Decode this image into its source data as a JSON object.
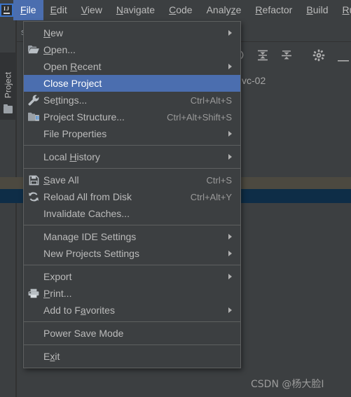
{
  "app": {
    "logo_text": "IJ",
    "logo_name": "intellij-idea-logo"
  },
  "menubar": {
    "items": [
      {
        "label": "File",
        "mnemonic": "F",
        "selected": true
      },
      {
        "label": "Edit",
        "mnemonic": "E",
        "selected": false
      },
      {
        "label": "View",
        "mnemonic": "V",
        "selected": false
      },
      {
        "label": "Navigate",
        "mnemonic": "N",
        "selected": false
      },
      {
        "label": "Code",
        "mnemonic": "C",
        "selected": false
      },
      {
        "label": "Analyze",
        "mnemonic": "z",
        "selected": false
      },
      {
        "label": "Refactor",
        "mnemonic": "R",
        "selected": false
      },
      {
        "label": "Build",
        "mnemonic": "B",
        "selected": false
      },
      {
        "label": "Run",
        "mnemonic": "R",
        "selected": false
      }
    ]
  },
  "tool_window": {
    "project_tab_label": "Project",
    "project_tab_icon": "folder-icon",
    "partial_label": "sp",
    "toolbar_icons": [
      {
        "name": "locate-icon"
      },
      {
        "name": "collapse-all-icon"
      },
      {
        "name": "expand-all-icon"
      },
      {
        "name": "gear-icon"
      },
      {
        "name": "minimize-icon"
      }
    ],
    "selected_node_text": "vc-02",
    "partial_node_text": "s"
  },
  "watermark": {
    "text": "CSDN @杨大脸I"
  },
  "file_menu": {
    "groups": [
      {
        "items": [
          {
            "label": "New",
            "mnemonic": "N",
            "icon": null,
            "shortcut": null,
            "submenu": true,
            "highlighted": false
          },
          {
            "label": "Open...",
            "mnemonic": "O",
            "icon": "open-folder-icon",
            "shortcut": null,
            "submenu": false,
            "highlighted": false
          },
          {
            "label": "Open Recent",
            "mnemonic": "R",
            "icon": null,
            "shortcut": null,
            "submenu": true,
            "highlighted": false
          },
          {
            "label": "Close Project",
            "mnemonic": null,
            "icon": null,
            "shortcut": null,
            "submenu": false,
            "highlighted": true
          },
          {
            "label": "Settings...",
            "mnemonic": "t",
            "icon": "wrench-icon",
            "shortcut": "Ctrl+Alt+S",
            "submenu": false,
            "highlighted": false
          },
          {
            "label": "Project Structure...",
            "mnemonic": null,
            "icon": "module-icon",
            "shortcut": "Ctrl+Alt+Shift+S",
            "submenu": false,
            "highlighted": false
          },
          {
            "label": "File Properties",
            "mnemonic": null,
            "icon": null,
            "shortcut": null,
            "submenu": true,
            "highlighted": false
          }
        ]
      },
      {
        "items": [
          {
            "label": "Local History",
            "mnemonic": "H",
            "icon": null,
            "shortcut": null,
            "submenu": true,
            "highlighted": false
          }
        ]
      },
      {
        "items": [
          {
            "label": "Save All",
            "mnemonic": "S",
            "icon": "save-icon",
            "shortcut": "Ctrl+S",
            "submenu": false,
            "highlighted": false
          },
          {
            "label": "Reload All from Disk",
            "mnemonic": null,
            "icon": "reload-icon",
            "shortcut": "Ctrl+Alt+Y",
            "submenu": false,
            "highlighted": false
          },
          {
            "label": "Invalidate Caches...",
            "mnemonic": null,
            "icon": null,
            "shortcut": null,
            "submenu": false,
            "highlighted": false
          }
        ]
      },
      {
        "items": [
          {
            "label": "Manage IDE Settings",
            "mnemonic": null,
            "icon": null,
            "shortcut": null,
            "submenu": true,
            "highlighted": false
          },
          {
            "label": "New Projects Settings",
            "mnemonic": null,
            "icon": null,
            "shortcut": null,
            "submenu": true,
            "highlighted": false
          }
        ]
      },
      {
        "items": [
          {
            "label": "Export",
            "mnemonic": null,
            "icon": null,
            "shortcut": null,
            "submenu": true,
            "highlighted": false
          },
          {
            "label": "Print...",
            "mnemonic": "P",
            "icon": "printer-icon",
            "shortcut": null,
            "submenu": false,
            "highlighted": false
          },
          {
            "label": "Add to Favorites",
            "mnemonic": "a",
            "icon": null,
            "shortcut": null,
            "submenu": true,
            "highlighted": false
          }
        ]
      },
      {
        "items": [
          {
            "label": "Power Save Mode",
            "mnemonic": null,
            "icon": null,
            "shortcut": null,
            "submenu": false,
            "highlighted": false
          }
        ]
      },
      {
        "items": [
          {
            "label": "Exit",
            "mnemonic": "x",
            "icon": null,
            "shortcut": null,
            "submenu": false,
            "highlighted": false
          }
        ]
      }
    ]
  },
  "colors": {
    "background": "#3c3f41",
    "menu_background": "#3c3f41",
    "menu_border": "#5e6060",
    "highlight": "#4b6eaf",
    "text": "#bbbbbb",
    "shortcut_text": "#9a9a9a",
    "olive_band": "#4c4940",
    "navy_band": "#0e2d47"
  }
}
